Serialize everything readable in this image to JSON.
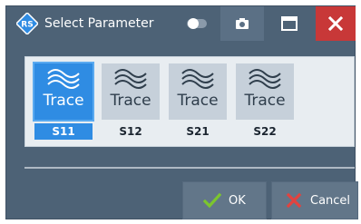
{
  "window": {
    "title": "Select Parameter"
  },
  "titlebar": {
    "toggle_icon": "toggle-icon",
    "camera_icon": "camera-icon",
    "maximize_icon": "maximize-icon",
    "close_icon": "close-icon",
    "close_color": "#c83838"
  },
  "tiles": [
    {
      "trace_label": "Trace",
      "param": "S11",
      "selected": true
    },
    {
      "trace_label": "Trace",
      "param": "S12",
      "selected": false
    },
    {
      "trace_label": "Trace",
      "param": "S21",
      "selected": false
    },
    {
      "trace_label": "Trace",
      "param": "S22",
      "selected": false
    }
  ],
  "footer": {
    "ok_label": "OK",
    "cancel_label": "Cancel",
    "ok_icon": "check-icon",
    "cancel_icon": "x-icon"
  },
  "colors": {
    "accent": "#2f8ce3",
    "titlebar": "#4d6276",
    "ok_check": "#7cc62d",
    "cancel_x": "#e2433f"
  }
}
